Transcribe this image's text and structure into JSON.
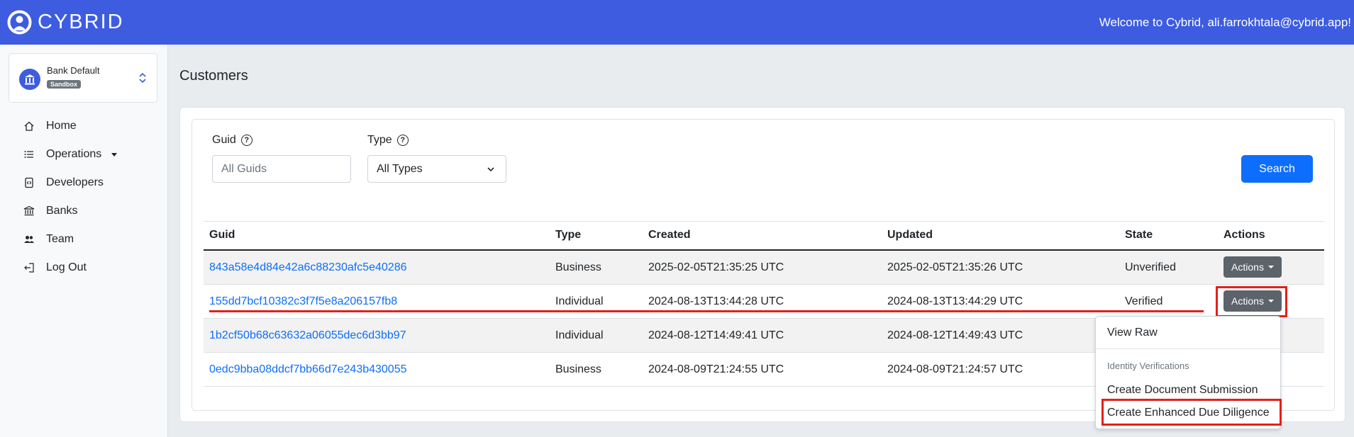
{
  "brand": {
    "name": "CYBRID"
  },
  "header": {
    "welcome": "Welcome to Cybrid, ali.farrokhtala@cybrid.app!"
  },
  "bank": {
    "name": "Bank Default",
    "badge": "Sandbox"
  },
  "sidebar": {
    "items": [
      {
        "label": "Home",
        "icon": "home-icon"
      },
      {
        "label": "Operations",
        "icon": "list-icon"
      },
      {
        "label": "Developers",
        "icon": "code-file-icon"
      },
      {
        "label": "Banks",
        "icon": "bank-icon"
      },
      {
        "label": "Team",
        "icon": "people-icon"
      },
      {
        "label": "Log Out",
        "icon": "logout-icon"
      }
    ]
  },
  "page": {
    "title": "Customers"
  },
  "filters": {
    "guid_label": "Guid",
    "guid_placeholder": "All Guids",
    "type_label": "Type",
    "type_value": "All Types",
    "search_label": "Search"
  },
  "table": {
    "headers": [
      "Guid",
      "Type",
      "Created",
      "Updated",
      "State",
      "Actions"
    ],
    "rows": [
      {
        "guid": "843a58e4d84e42a6c88230afc5e40286",
        "type": "Business",
        "created": "2025-02-05T21:35:25 UTC",
        "updated": "2025-02-05T21:35:26 UTC",
        "state": "Unverified",
        "actions": "Actions"
      },
      {
        "guid": "155dd7bcf10382c3f7f5e8a206157fb8",
        "type": "Individual",
        "created": "2024-08-13T13:44:28 UTC",
        "updated": "2024-08-13T13:44:29 UTC",
        "state": "Verified",
        "actions": "Actions"
      },
      {
        "guid": "1b2cf50b68c63632a06055dec6d3bb97",
        "type": "Individual",
        "created": "2024-08-12T14:49:41 UTC",
        "updated": "2024-08-12T14:49:43 UTC",
        "state": "",
        "actions": ""
      },
      {
        "guid": "0edc9bba08ddcf7bb66d7e243b430055",
        "type": "Business",
        "created": "2024-08-09T21:24:55 UTC",
        "updated": "2024-08-09T21:24:57 UTC",
        "state": "",
        "actions": ""
      }
    ]
  },
  "dropdown": {
    "view_raw": "View Raw",
    "section_header": "Identity Verifications",
    "create_document": "Create Document Submission",
    "create_edd": "Create Enhanced Due Diligence"
  },
  "colors": {
    "brand": "#3d5ce0",
    "primary": "#0d6efd",
    "annotation": "#e3201b"
  }
}
